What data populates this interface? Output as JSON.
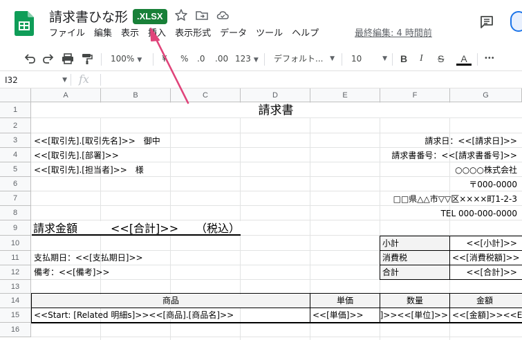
{
  "app": {
    "doc_title": "請求書ひな形",
    "file_badge": ".XLSX",
    "last_edit": "最終編集: 4 時間前"
  },
  "icons": {
    "logo": "sheets-logo-icon",
    "star": "star-icon",
    "move": "move-to-folder-icon",
    "cloud": "cloud-status-icon",
    "comments": "comments-icon",
    "undo": "undo-icon",
    "redo": "redo-icon",
    "print": "print-icon",
    "paint_format": "paint-format-icon",
    "bold": "bold-icon",
    "italic": "italic-icon",
    "strikethrough": "strikethrough-icon",
    "text_color": "text-color-icon",
    "more": "more-icon",
    "fx": "fx-icon"
  },
  "colors": {
    "brand_green": "#188038",
    "arrow": "#e0447a",
    "header_bg": "#f8f9fa",
    "shade": "#f3f3f3"
  },
  "menu": [
    "ファイル",
    "編集",
    "表示",
    "挿入",
    "表示形式",
    "データ",
    "ツール",
    "ヘルプ"
  ],
  "toolbar": {
    "zoom": "100%",
    "currency": "¥",
    "percent": "%",
    "dec_decrease": ".0",
    "dec_increase": ".00",
    "number_format": "123",
    "font": "デフォルト...",
    "font_size": "10",
    "text_color_letter": "A",
    "more": "•••"
  },
  "formula_bar": {
    "cell_ref": "I32",
    "fx": "fx",
    "value": ""
  },
  "columns": [
    "A",
    "B",
    "C",
    "D",
    "E",
    "F",
    "G"
  ],
  "rows": [
    "1",
    "2",
    "3",
    "4",
    "5",
    "6",
    "7",
    "8",
    "9",
    "10",
    "11",
    "12",
    "13",
    "14",
    "15",
    "16"
  ],
  "sheet": {
    "title": "請求書",
    "client_name": "<<[取引先].[取引先名]>>　御中",
    "client_dept": "<<[取引先].[部署]>>",
    "client_contact": "<<[取引先].[担当者]>>　様",
    "invoice_date": "請求日：<<[請求日]>>",
    "invoice_number": "請求書番号：<<[請求書番号]>>",
    "company_name": "○○○○株式会社",
    "postal_code": "〒000-0000",
    "address": "□□県△△市▽▽区××××町1-2-3",
    "tel": "TEL 000-000-0000",
    "amount_label": "請求金額",
    "amount_value": "<<[合計]>>",
    "amount_tax": "（税込）",
    "subtotal_label": "小計",
    "subtotal_value": "<<[小計]>>",
    "tax_label": "消費税",
    "tax_value": "<<[消費税額]>>",
    "total_label": "合計",
    "total_value": "<<[合計]>>",
    "due_date": "支払期日：<<[支払期日]>>",
    "note": "備考：<<[備考]>>",
    "items_header": [
      "商品",
      "単価",
      "数量",
      "金額"
    ],
    "item_row": [
      "<<Start: [Related 明細s]>><<[商品].[商品名]>>",
      "<<[単価]>>",
      "<<[数量]>><<[単位]>>",
      "<<[金額]>><<End"
    ]
  }
}
